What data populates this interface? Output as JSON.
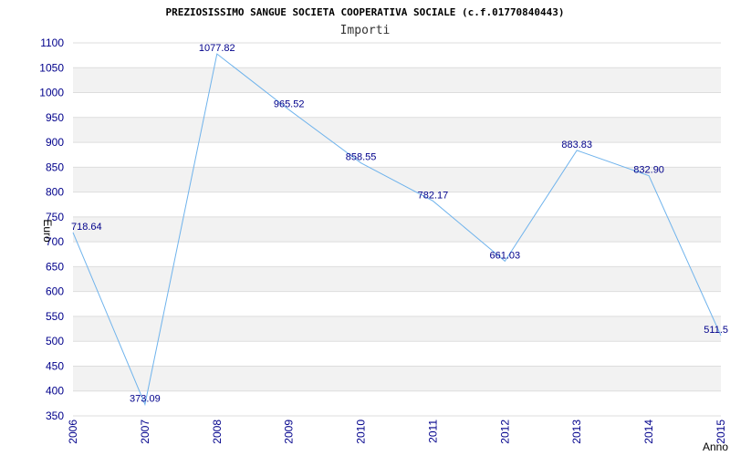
{
  "chart_data": {
    "type": "line",
    "title": "PREZIOSISSIMO SANGUE SOCIETA COOPERATIVA SOCIALE (c.f.01770840443)",
    "subtitle": "Importi",
    "xlabel": "Anno",
    "ylabel": "Euro",
    "x": [
      "2006",
      "2007",
      "2008",
      "2009",
      "2010",
      "2011",
      "2012",
      "2013",
      "2014",
      "2015"
    ],
    "values": [
      718.64,
      373.09,
      1077.82,
      965.52,
      858.55,
      782.17,
      661.03,
      883.83,
      832.9,
      511.5
    ],
    "value_labels": [
      "718.64",
      "373.09",
      "1077.82",
      "965.52",
      "858.55",
      "782.17",
      "661.03",
      "883.83",
      "832.90",
      "511.5"
    ],
    "yticks": [
      "350",
      "400",
      "450",
      "500",
      "550",
      "600",
      "650",
      "700",
      "750",
      "800",
      "850",
      "900",
      "950",
      "1000",
      "1050",
      "1100"
    ],
    "ylim": [
      350,
      1100
    ],
    "grid": true,
    "legend": "none",
    "colors": {
      "line": "#6fb3ec",
      "band": "#f2f2f2",
      "gridline": "#dddddd",
      "tick_text": "#00008b"
    }
  }
}
